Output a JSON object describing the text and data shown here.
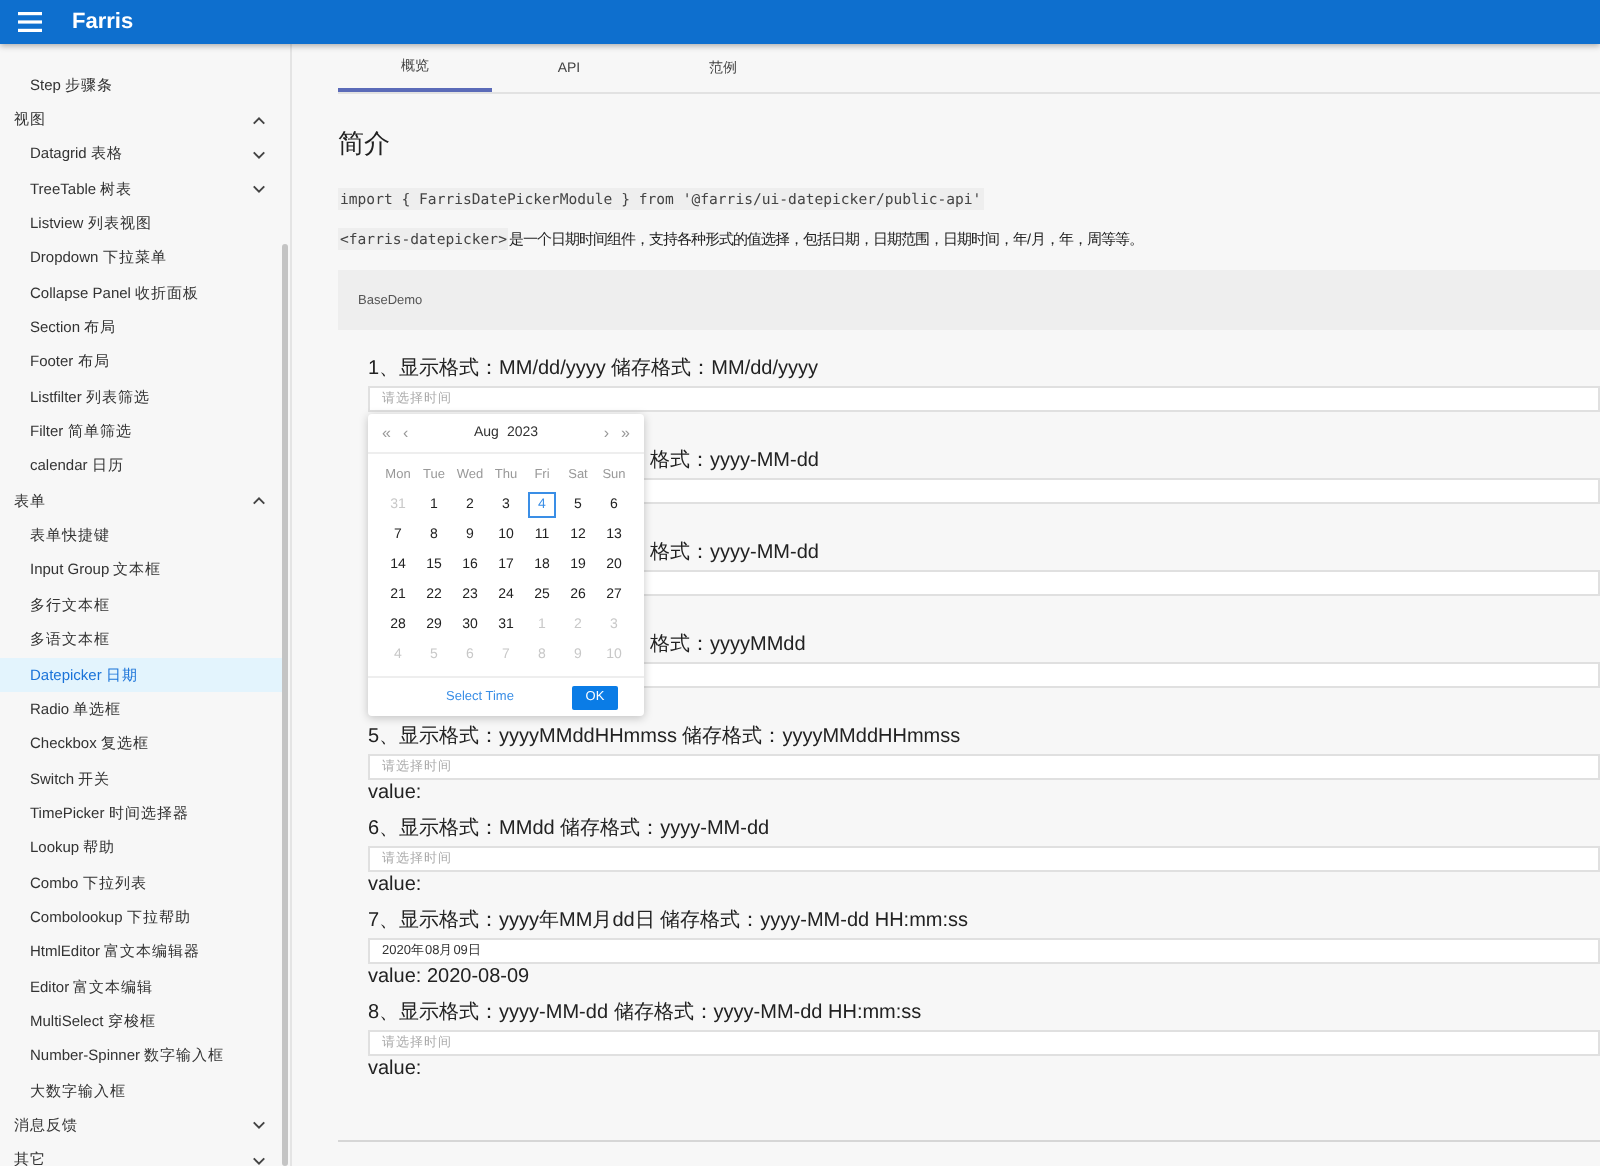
{
  "app_bar": {
    "title": "Farris"
  },
  "sidebar": {
    "items": [
      {
        "label": "Step 步骤条",
        "kind": "link",
        "selected": false
      },
      {
        "label": "视图",
        "kind": "group",
        "expanded": true,
        "selected": false,
        "children": [
          {
            "label": "Datagrid 表格",
            "kind": "group",
            "expanded": false,
            "selected": false
          },
          {
            "label": "TreeTable 树表",
            "kind": "group",
            "expanded": false,
            "selected": false
          },
          {
            "label": "Listview 列表视图",
            "kind": "link",
            "selected": false
          },
          {
            "label": "Dropdown 下拉菜单",
            "kind": "link",
            "selected": false
          },
          {
            "label": "Collapse Panel 收折面板",
            "kind": "link",
            "selected": false
          },
          {
            "label": "Section 布局",
            "kind": "link",
            "selected": false
          },
          {
            "label": "Footer 布局",
            "kind": "link",
            "selected": false
          },
          {
            "label": "Listfilter 列表筛选",
            "kind": "link",
            "selected": false
          },
          {
            "label": "Filter 简单筛选",
            "kind": "link",
            "selected": false
          },
          {
            "label": "calendar 日历",
            "kind": "link",
            "selected": false
          }
        ]
      },
      {
        "label": "表单",
        "kind": "group",
        "expanded": true,
        "selected": false,
        "children": [
          {
            "label": "表单快捷键",
            "kind": "link",
            "selected": false
          },
          {
            "label": "Input Group 文本框",
            "kind": "link",
            "selected": false
          },
          {
            "label": "多行文本框",
            "kind": "link",
            "selected": false
          },
          {
            "label": "多语文本框",
            "kind": "link",
            "selected": false
          },
          {
            "label": "Datepicker 日期",
            "kind": "link",
            "selected": true
          },
          {
            "label": "Radio 单选框",
            "kind": "link",
            "selected": false
          },
          {
            "label": "Checkbox 复选框",
            "kind": "link",
            "selected": false
          },
          {
            "label": "Switch 开关",
            "kind": "link",
            "selected": false
          },
          {
            "label": "TimePicker 时间选择器",
            "kind": "link",
            "selected": false
          },
          {
            "label": "Lookup 帮助",
            "kind": "link",
            "selected": false
          },
          {
            "label": "Combo 下拉列表",
            "kind": "link",
            "selected": false
          },
          {
            "label": "Combolookup 下拉帮助",
            "kind": "link",
            "selected": false
          },
          {
            "label": "HtmlEditor 富文本编辑器",
            "kind": "link",
            "selected": false
          },
          {
            "label": "Editor 富文本编辑",
            "kind": "link",
            "selected": false
          },
          {
            "label": "MultiSelect 穿梭框",
            "kind": "link",
            "selected": false
          },
          {
            "label": "Number-Spinner 数字输入框",
            "kind": "link",
            "selected": false
          },
          {
            "label": "大数字输入框",
            "kind": "link",
            "selected": false
          }
        ]
      },
      {
        "label": "消息反馈",
        "kind": "group",
        "expanded": false,
        "selected": false
      },
      {
        "label": "其它",
        "kind": "group",
        "expanded": false,
        "selected": false
      }
    ]
  },
  "tabs": [
    {
      "label": "概览",
      "selected": true
    },
    {
      "label": "API",
      "selected": false
    },
    {
      "label": "范例",
      "selected": false
    }
  ],
  "intro": {
    "heading": "简介",
    "import_code": "import { FarrisDatePickerModule } from '@farris/ui-datepicker/public-api'",
    "tag_code": "<farris-datepicker>",
    "description": "是一个日期时间组件，支持各种形式的值选择，包括日期，日期范围，日期时间，年/月，年，周等等。"
  },
  "demo_card": {
    "title": "BaseDemo",
    "demos": [
      {
        "label": "1、显示格式：MM/dd/yyyy 储存格式：MM/dd/yyyy",
        "covered": false,
        "placeholder": "请选择时间"
      },
      {
        "label": "格式：yyyy-MM-dd",
        "covered": true
      },
      {
        "label": "格式：yyyy-MM-dd",
        "covered": true
      },
      {
        "label": "格式：yyyyMMdd",
        "covered": true
      },
      {
        "label": "5、显示格式：yyyyMMddHHmmss 储存格式：yyyyMMddHHmmss",
        "covered": false,
        "placeholder": "请选择时间",
        "value": "value:"
      },
      {
        "label": "6、显示格式：MMdd 储存格式：yyyy-MM-dd",
        "covered": false,
        "placeholder": "请选择时间",
        "value": "value:"
      },
      {
        "label": "7、显示格式：yyyy年MM月dd日 储存格式：yyyy-MM-dd HH:mm:ss",
        "covered": false,
        "input_value": "2020年08月09日",
        "value": "value: 2020-08-09"
      },
      {
        "label": "8、显示格式：yyyy-MM-dd 储存格式：yyyy-MM-dd HH:mm:ss",
        "covered": false,
        "placeholder": "请选择时间",
        "value": "value:"
      }
    ]
  },
  "date_popup": {
    "month": "Aug",
    "year": "2023",
    "prev_year": "«",
    "prev_month": "‹",
    "next_month": "›",
    "next_year": "»",
    "weekdays": [
      "Mon",
      "Tue",
      "Wed",
      "Thu",
      "Fri",
      "Sat",
      "Sun"
    ],
    "days": [
      {
        "label": "31",
        "muted": true,
        "selected": false
      },
      {
        "label": "1",
        "muted": false,
        "selected": false
      },
      {
        "label": "2",
        "muted": false,
        "selected": false
      },
      {
        "label": "3",
        "muted": false,
        "selected": false
      },
      {
        "label": "4",
        "muted": false,
        "selected": true
      },
      {
        "label": "5",
        "muted": false,
        "selected": false
      },
      {
        "label": "6",
        "muted": false,
        "selected": false
      },
      {
        "label": "7",
        "muted": false,
        "selected": false
      },
      {
        "label": "8",
        "muted": false,
        "selected": false
      },
      {
        "label": "9",
        "muted": false,
        "selected": false
      },
      {
        "label": "10",
        "muted": false,
        "selected": false
      },
      {
        "label": "11",
        "muted": false,
        "selected": false
      },
      {
        "label": "12",
        "muted": false,
        "selected": false
      },
      {
        "label": "13",
        "muted": false,
        "selected": false
      },
      {
        "label": "14",
        "muted": false,
        "selected": false
      },
      {
        "label": "15",
        "muted": false,
        "selected": false
      },
      {
        "label": "16",
        "muted": false,
        "selected": false
      },
      {
        "label": "17",
        "muted": false,
        "selected": false
      },
      {
        "label": "18",
        "muted": false,
        "selected": false
      },
      {
        "label": "19",
        "muted": false,
        "selected": false
      },
      {
        "label": "20",
        "muted": false,
        "selected": false
      },
      {
        "label": "21",
        "muted": false,
        "selected": false
      },
      {
        "label": "22",
        "muted": false,
        "selected": false
      },
      {
        "label": "23",
        "muted": false,
        "selected": false
      },
      {
        "label": "24",
        "muted": false,
        "selected": false
      },
      {
        "label": "25",
        "muted": false,
        "selected": false
      },
      {
        "label": "26",
        "muted": false,
        "selected": false
      },
      {
        "label": "27",
        "muted": false,
        "selected": false
      },
      {
        "label": "28",
        "muted": false,
        "selected": false
      },
      {
        "label": "29",
        "muted": false,
        "selected": false
      },
      {
        "label": "30",
        "muted": false,
        "selected": false
      },
      {
        "label": "31",
        "muted": false,
        "selected": false
      },
      {
        "label": "1",
        "muted": true,
        "selected": false
      },
      {
        "label": "2",
        "muted": true,
        "selected": false
      },
      {
        "label": "3",
        "muted": true,
        "selected": false
      },
      {
        "label": "4",
        "muted": true,
        "selected": false
      },
      {
        "label": "5",
        "muted": true,
        "selected": false
      },
      {
        "label": "6",
        "muted": true,
        "selected": false
      },
      {
        "label": "7",
        "muted": true,
        "selected": false
      },
      {
        "label": "8",
        "muted": true,
        "selected": false
      },
      {
        "label": "9",
        "muted": true,
        "selected": false
      },
      {
        "label": "10",
        "muted": true,
        "selected": false
      }
    ],
    "select_time": "Select Time",
    "ok": "OK"
  }
}
